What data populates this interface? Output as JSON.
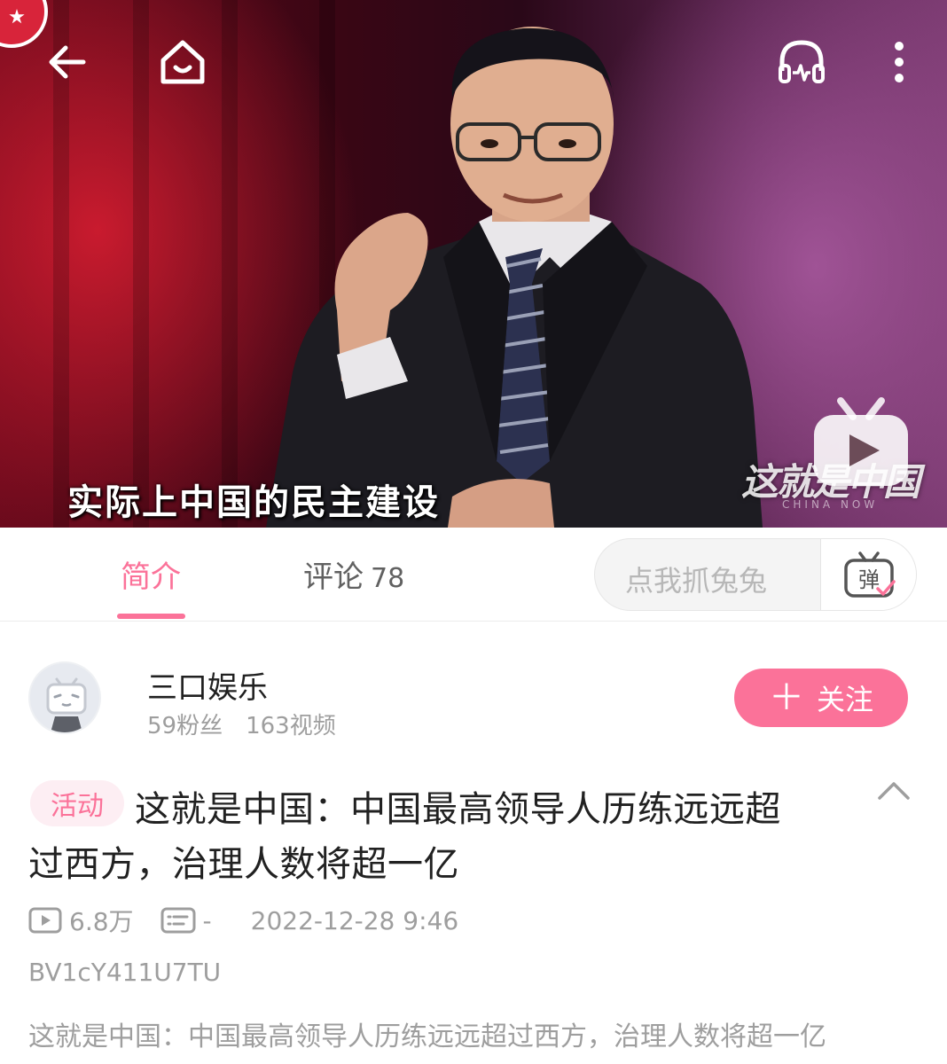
{
  "video": {
    "subtitle": "实际上中国的民主建设",
    "watermark": "这就是中国",
    "watermark_sub": "CHINA NOW"
  },
  "top_bar": {
    "icons": [
      "back-arrow-icon",
      "home-icon",
      "audio-mode-icon",
      "more-icon"
    ]
  },
  "tabs": [
    {
      "label": "简介",
      "active": true
    },
    {
      "label": "评论",
      "count": "78",
      "active": false
    }
  ],
  "danmaku": {
    "placeholder": "点我抓兔兔",
    "toggle_icon": "弹"
  },
  "uploader": {
    "name": "三口娱乐",
    "fans": "59粉丝",
    "videos": "163视频",
    "follow_label": "关注"
  },
  "video_info": {
    "badge": "活动",
    "title_line1": "这就是中国：中国最高领导人历练远远超",
    "title_line2": "过西方，治理人数将超一亿",
    "views": "6.8万",
    "danmaku_count": "-",
    "published": "2022-12-28 9:46",
    "bvid": "BV1cY411U7TU",
    "description": "这就是中国：中国最高领导人历练远远超过西方，治理人数将超一亿"
  },
  "colors": {
    "accent": "#fb7299",
    "secondary_text": "#9e9e9e"
  }
}
